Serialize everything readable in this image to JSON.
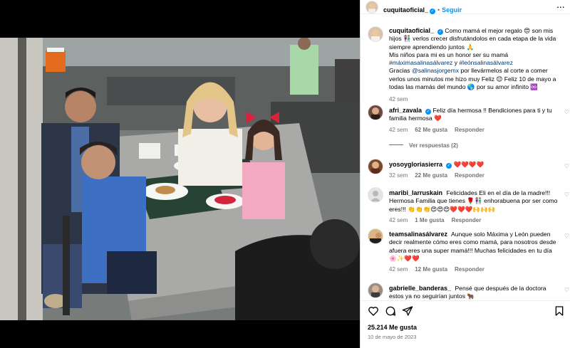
{
  "header": {
    "username": "cuquitaoficial_",
    "separator": "•",
    "follow_label": "Seguir",
    "more_label": "..."
  },
  "caption": {
    "username": "cuquitaoficial_",
    "text1": "Como mamá el mejor regalo 😍 son mis hijos 👫 verlos crecer disfrutándolos en cada etapa de la vida siempre aprendiendo juntos 🙏",
    "text2": "Mis niños para mi es un honor ser su mamá",
    "hashtag1": "#máximasalinasálvarez",
    "conj": "y",
    "hashtag2": "#leónsalinasálvarez",
    "text3_pre": "Gracias",
    "mention": "@salinasjorgemx",
    "text3_post": "por llevármelos al corte a comer verlos unos minutos me hizo muy Feliz 😊 Feliz 10 de mayo a todas las mamás del mundo 🌎 por su amor infinito ♾️",
    "time": "42 sem"
  },
  "comments": [
    {
      "username": "afri_zavala",
      "text": "Feliz día hermosa !! Bendiciones para ti y tu familia hermosa ❤️",
      "time": "42 sem",
      "likes": "62 Me gusta",
      "reply": "Responder"
    },
    {
      "username": "yosoygloriasierra",
      "text": "❤️❤️❤️❤️",
      "time": "32 sem",
      "likes": "22 Me gusta",
      "reply": "Responder"
    },
    {
      "username": "maribi_larruskain",
      "text": "Felicidades Eli en el día de la madre!!! Hermosa Familia que tienes 🌹👫 enhorabuena por ser como eres!!! 👏👏👏😍😍😍❤️❤️❤️🙌🙌🙌",
      "time": "42 sem",
      "likes": "1 Me gusta",
      "reply": "Responder"
    },
    {
      "username": "teamsalinasálvarez",
      "text": "Aunque solo Máxima y León pueden decir realmente cómo eres como mamá, para nosotros desde afuera eres una super mamá!!! Muchas felicidades en tu día 🌸✨❤️❤️",
      "time": "42 sem",
      "likes": "12 Me gusta",
      "reply": "Responder"
    },
    {
      "username": "gabrielle_banderas_",
      "text": "Pensé que después de la doctora estos ya no seguirían juntos 🐂",
      "time": "",
      "likes": "",
      "reply": ""
    }
  ],
  "view_replies": "Ver respuestas (2)",
  "actions": {
    "likes": "25.214 Me gusta",
    "date": "10 de mayo de 2023"
  },
  "colors": {
    "accent": "#0095f6",
    "muted": "#737373",
    "hashtag": "#00376b",
    "divider": "#efefef"
  },
  "icons": [
    "heart-icon",
    "comment-icon",
    "share-icon",
    "bookmark-icon",
    "verified-badge-icon",
    "more-icon"
  ]
}
